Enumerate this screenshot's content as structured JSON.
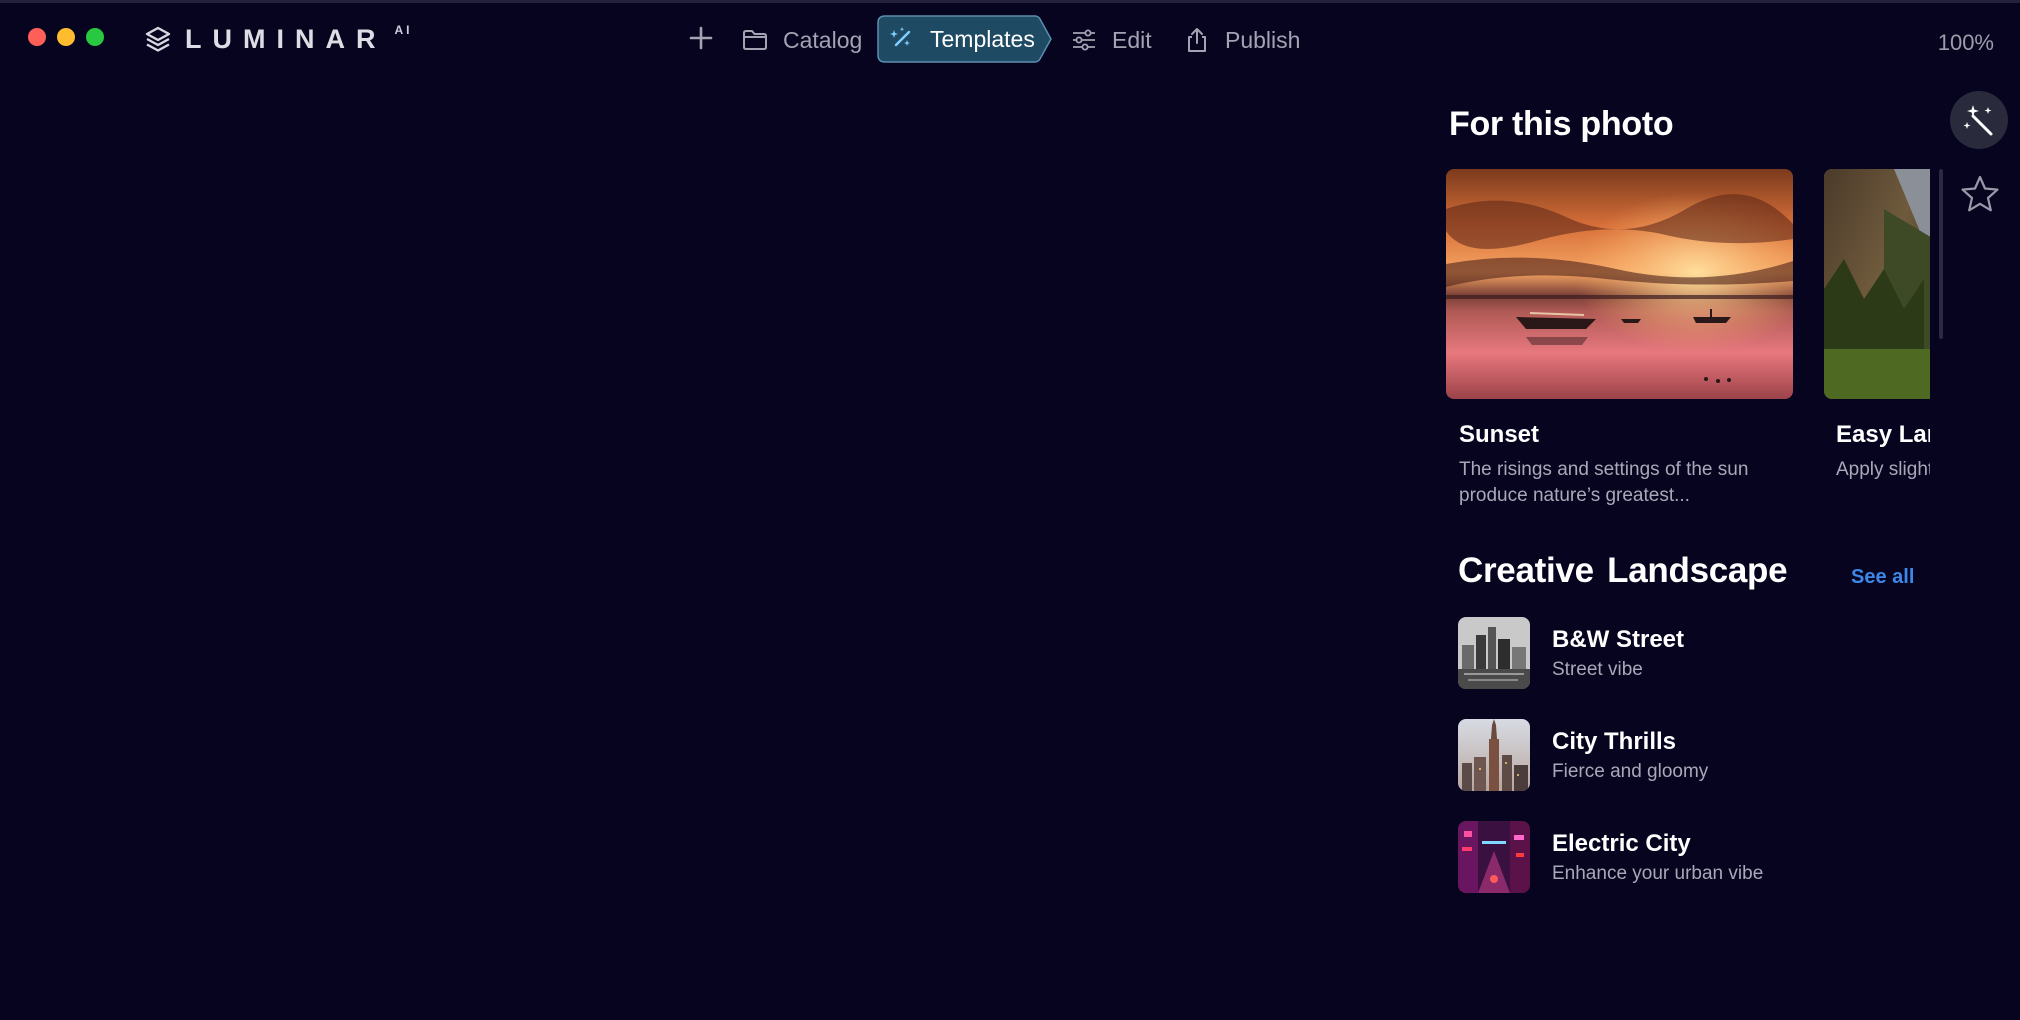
{
  "window": {
    "zoom": "100%"
  },
  "brand": {
    "name": "LUMINAR",
    "suffix": "AI"
  },
  "nav": {
    "catalog": "Catalog",
    "templates": "Templates",
    "edit": "Edit",
    "publish": "Publish"
  },
  "for_this_photo": {
    "title": "For this photo",
    "cards": [
      {
        "title": "Sunset",
        "description": "The risings and settings of the sun produce nature’s greatest..."
      },
      {
        "title": "Easy Landscapes",
        "description": "Apply slight light and b"
      }
    ]
  },
  "creative_landscape": {
    "title": "Creative Landscape",
    "see_all": "See all",
    "items": [
      {
        "title": "B&W Street",
        "subtitle": "Street vibe"
      },
      {
        "title": "City Thrills",
        "subtitle": "Fierce and gloomy"
      },
      {
        "title": "Electric City",
        "subtitle": "Enhance your urban vibe"
      }
    ]
  },
  "colors": {
    "background": "#07041f",
    "accent_link": "#3c87e8",
    "active_tab": "#1f4a63",
    "text_primary": "#ffffff",
    "text_secondary": "#a9a8b8"
  },
  "icons": {
    "add": "plus-icon",
    "catalog": "folder-icon",
    "templates": "magic-wand-icon",
    "edit": "sliders-icon",
    "publish": "share-icon",
    "rail_templates": "magic-wand-icon",
    "rail_favorites": "star-icon"
  }
}
